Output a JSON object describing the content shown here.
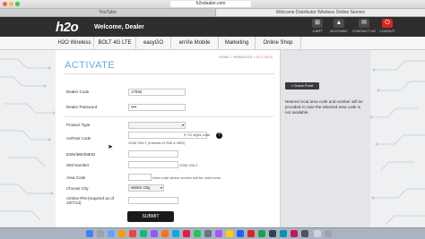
{
  "browser": {
    "url": "h2odealer.com"
  },
  "tabs": [
    {
      "label": "YouTube"
    },
    {
      "label": "Welcome Distributor Wireless Online Service"
    }
  ],
  "header": {
    "logo": "h2o",
    "welcome": "Welcome, Dealer",
    "icons": [
      {
        "label": "CART",
        "glyph": "⊞"
      },
      {
        "label": "ACCOUNT",
        "glyph": "▲"
      },
      {
        "label": "CONTACT US",
        "glyph": "✉"
      },
      {
        "label": "LOGOUT",
        "glyph": "⏻"
      }
    ]
  },
  "nav": [
    "H2O Wireless",
    "BOLT 4G LTE",
    "easyGO",
    "enVie Mobile",
    "Marketing",
    "Online Shop"
  ],
  "breadcrumb": {
    "path": "HOME > WIRELESS > ",
    "current": "ACTIVATE"
  },
  "page_title": "ACTIVATE",
  "form": {
    "dealer_code_label": "Dealer Code",
    "dealer_code_value": "17832",
    "dealer_password_label": "Dealer Password",
    "dealer_password_value": "••••",
    "product_type_label": "Product Type",
    "actfast_label": "ActFast Code",
    "actfast_hint": "9~10 digits code",
    "actfast_note": "GSM ONLY (Instead of SIM & IMEI)",
    "esn_label": "ESN/IMEI/MEID",
    "sim_label": "SIM Number",
    "sim_note": "GSM ONLY",
    "area_code_label": "Area Code",
    "area_code_note": "Area code where service will be used most",
    "city_label": "Choose City",
    "city_value": "Select City",
    "pin_label": "Airtime PIN (required as of 10/7/13)",
    "submit_label": "SUBMIT"
  },
  "sidebar": {
    "button": "Check Point",
    "text": "Nearest local area code and number will be provided in case the selected area code is not available."
  },
  "colors": {
    "accent": "#6aa9d6",
    "header": "#2e2e30",
    "logout": "#d9261c"
  }
}
